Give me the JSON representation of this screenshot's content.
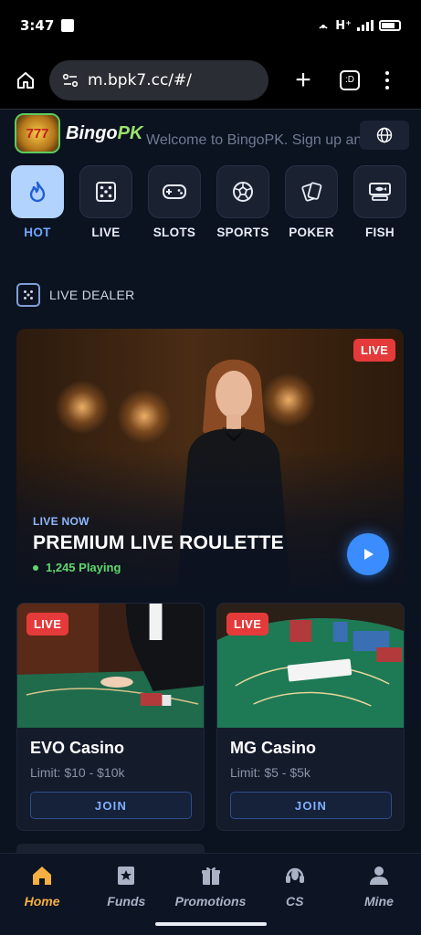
{
  "status_bar": {
    "time": "3:47",
    "network": "H⁺"
  },
  "browser": {
    "url": "m.bpk7.cc/#/",
    "tabs_label": ":D"
  },
  "header": {
    "logo_text_1": "Bingo",
    "logo_text_2": "PK",
    "logo_badge": "777",
    "marquee": "Welcome to BingoPK. Sign up and deposit now"
  },
  "categories": [
    {
      "label": "HOT",
      "icon": "flame-icon",
      "active": true
    },
    {
      "label": "LIVE",
      "icon": "dice-icon"
    },
    {
      "label": "SLOTS",
      "icon": "gamepad-icon"
    },
    {
      "label": "SPORTS",
      "icon": "soccer-ball-icon"
    },
    {
      "label": "POKER",
      "icon": "cards-icon"
    },
    {
      "label": "FISH",
      "icon": "fish-machine-icon"
    }
  ],
  "section": {
    "title": "LIVE DEALER"
  },
  "hero": {
    "badge": "LIVE",
    "kicker": "LIVE NOW",
    "title": "PREMIUM LIVE ROULETTE",
    "playing": "1,245 Playing"
  },
  "games": [
    {
      "badge": "LIVE",
      "name": "EVO Casino",
      "limit": "Limit: $10 - $10k",
      "join": "JOIN"
    },
    {
      "badge": "LIVE",
      "name": "MG Casino",
      "limit": "Limit: $5 - $5k",
      "join": "JOIN"
    }
  ],
  "bottom_nav": [
    {
      "label": "Home",
      "icon": "home-icon",
      "active": true
    },
    {
      "label": "Funds",
      "icon": "wallet-icon"
    },
    {
      "label": "Promotions",
      "icon": "gift-icon"
    },
    {
      "label": "CS",
      "icon": "headset-icon"
    },
    {
      "label": "Mine",
      "icon": "user-icon"
    }
  ],
  "colors": {
    "accent": "#3a8cff",
    "live": "#e53a3a",
    "active_nav": "#f5b041",
    "playing": "#5fd76e"
  }
}
